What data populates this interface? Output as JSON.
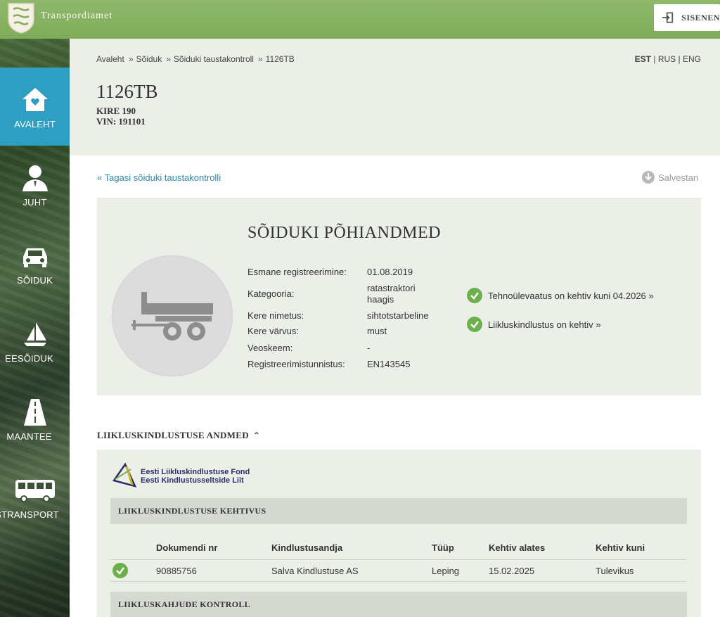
{
  "header": {
    "brand": "Transpordiamet",
    "login_label": "SISENEN"
  },
  "sidebar": {
    "items": [
      {
        "label": "AVALEHT",
        "icon": "house-icon",
        "active": true
      },
      {
        "label": "JUHT",
        "icon": "person-icon"
      },
      {
        "label": "SÕIDUK",
        "icon": "car-icon"
      },
      {
        "label": "EESÕIDUK",
        "icon": "sailboat-icon"
      },
      {
        "label": "MAANTEE",
        "icon": "road-icon"
      },
      {
        "label": "STRANSPORT",
        "icon": "bus-icon"
      }
    ]
  },
  "breadcrumb": {
    "items": [
      "Avaleht",
      "Sõiduk",
      "Sõiduki taustakontroll",
      "1126TB"
    ],
    "separator": "»"
  },
  "languages": {
    "est": "EST",
    "rus": "RUS",
    "eng": "ENG",
    "divider": "|"
  },
  "vehicle": {
    "plate": "1126TB",
    "make_model": "KIRE 190",
    "vin": "VIN: 191101"
  },
  "actions": {
    "back_link": "« Tagasi sõiduki taustakontrolli",
    "save_label": "Salvestan"
  },
  "basic_data": {
    "title": "SÕIDUKI PÕHIANDMED",
    "fields": [
      {
        "key": "Esmane registreerimine:",
        "value": "01.08.2019"
      },
      {
        "key": "Kategooria:",
        "value": "ratastraktori haagis"
      },
      {
        "key": "Kere nimetus:",
        "value": "sihtotstarbeline"
      },
      {
        "key": "Kere värvus:",
        "value": "must"
      },
      {
        "key": "Veoskeem:",
        "value": "-"
      },
      {
        "key": "Registreerimistunnistus:",
        "value": "EN143545"
      }
    ],
    "statuses": [
      {
        "text": "Tehnoülevaatus on kehtiv kuni 04.2026 »"
      },
      {
        "text": "Liikluskindlustus on kehtiv »"
      }
    ]
  },
  "insurance": {
    "section_title": "LIIKLUSKINDLUSTUSE ANDMED",
    "fund_name_1": "Eesti Liikluskindlustuse Fond",
    "fund_name_2": "Eesti Kindlustusseltside Liit",
    "validity_title": "LIIKLUSKINDLUSTUSE KEHTIVUS",
    "columns": [
      "Dokumendi nr",
      "Kindlustusandja",
      "Tüüp",
      "Kehtiv alates",
      "Kehtiv kuni"
    ],
    "rows": [
      [
        "90885756",
        "Salva Kindlustuse AS",
        "Leping",
        "15.02.2025",
        "Tulevikus"
      ]
    ],
    "damage_title": "LIIKLUSKAHJUDE KONTROLL"
  },
  "colors": {
    "topbar": "#7fac5a",
    "active_nav": "#2e9fc2",
    "link": "#2e88b0",
    "check": "#6cb04d"
  }
}
